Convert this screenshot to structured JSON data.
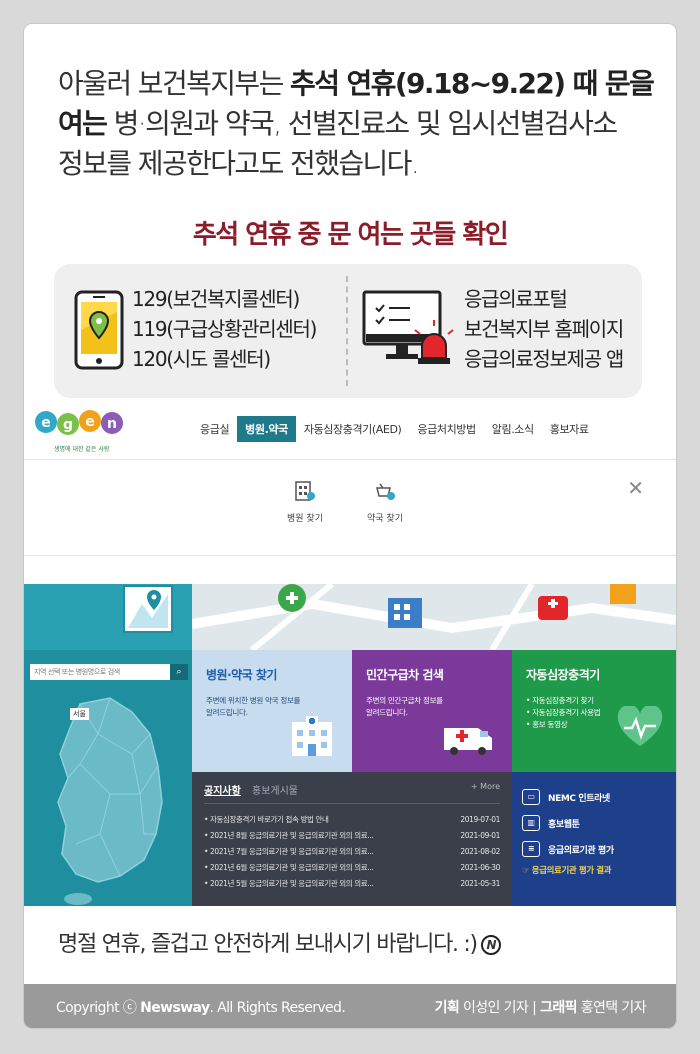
{
  "intro": {
    "line1_a": "아울러 보건복지부는 ",
    "line1_b": "추석 연휴(9.18~9.22) 때 문을",
    "line2_a": "여는",
    "line2_b": " 병·의원과 약국, 선별진료소 및 임시선별검사소",
    "line3": "정보를 제공한다고도 전했습니다."
  },
  "headline": "추석 연휴 중 문 여는 곳들 확인",
  "phone_lines": [
    "129(보건복지콜센터)",
    "119(구급상황관리센터)",
    "120(시도 콜센터)"
  ],
  "web_lines": [
    "응급의료포털",
    "보건복지부 홈페이지",
    "응급의료정보제공 앱"
  ],
  "site": {
    "logo_text": "egen",
    "logo_sub": "생명에 대한 같은 사랑",
    "nav": [
      "응급실",
      "병원.약국",
      "자동심장충격기(AED)",
      "응급처치방법",
      "알림.소식",
      "홍보자료"
    ],
    "nav_active": "병원.약국",
    "submenu": [
      "병원 찾기",
      "약국 찾기"
    ],
    "close": "✕",
    "search_placeholder": "지역 선택 또는 병원명으로 검색",
    "seoul": "서울",
    "tiles": [
      {
        "title": "병원·약국 찾기",
        "desc1": "주변에 위치한 병원 약국 정보를",
        "desc2": "알려드립니다."
      },
      {
        "title": "민간구급차 검색",
        "desc1": "주변의 민간구급차 정보를",
        "desc2": "알려드립니다."
      },
      {
        "title": "자동심장충격기",
        "items": [
          "• 자동심장충격기 찾기",
          "• 자동심장충격기 사용법",
          "• 홍보 동영상"
        ]
      }
    ],
    "notice": {
      "tab1": "공지사항",
      "tab2": "홍보게시물",
      "more": "+ More",
      "rows": [
        {
          "title": "• 자동심장충격기 바로가기 접속 방법 안내",
          "date": "2019-07-01"
        },
        {
          "title": "• 2021년 8월 응급의료기관 및 응급의료기관 외의 의료...",
          "date": "2021-09-01"
        },
        {
          "title": "• 2021년 7월 응급의료기관 및 응급의료기관 외의 의료...",
          "date": "2021-08-02"
        },
        {
          "title": "• 2021년 6월 응급의료기관 및 응급의료기관 외의 의료...",
          "date": "2021-06-30"
        },
        {
          "title": "• 2021년 5월 응급의료기관 및 응급의료기관 외의 의료...",
          "date": "2021-05-31"
        }
      ]
    },
    "links": [
      "NEMC 인트라넷",
      "홍보웹툰",
      "응급의료기관 평가"
    ],
    "link_result": "☞ 응급의료기관 평가 결과"
  },
  "closing": "명절 연휴, 즐겁고 안전하게 보내시기 바랍니다. :)",
  "closing_badge": "N",
  "footer": {
    "copy_a": "Copyright ⓒ ",
    "copy_b": "Newsway",
    "copy_c": ". All Rights Reserved.",
    "credit_a": "기획",
    "credit_b": " 이성인 기자 | ",
    "credit_c": "그래픽",
    "credit_d": " 홍연택 기자"
  },
  "colors": {
    "headline": "#8b1c2a",
    "nav_active": "#1f7a8c",
    "hospital_tile": "#c8dcf0",
    "ambulance_tile": "#7b3a9a",
    "aed_tile": "#1f9a4a",
    "links_panel": "#1e3f8a"
  }
}
